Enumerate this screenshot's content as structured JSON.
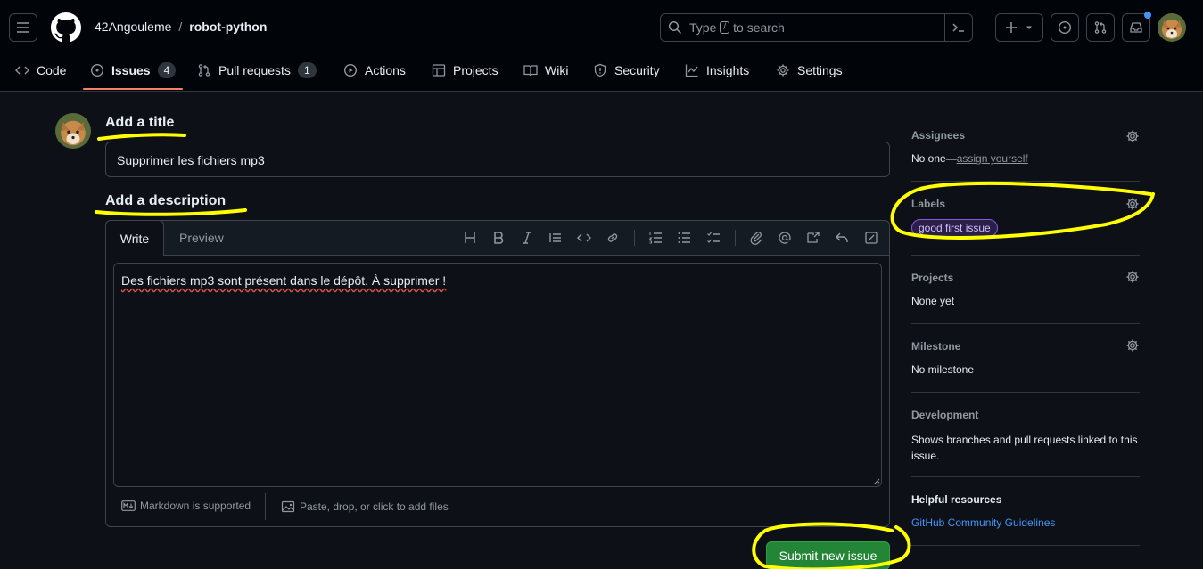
{
  "header": {
    "owner": "42Angouleme",
    "separator": "/",
    "repo": "robot-python",
    "search": {
      "prefix": "Type",
      "key": "/",
      "suffix": "to search"
    }
  },
  "tabs": [
    {
      "label": "Code",
      "icon": "code-icon"
    },
    {
      "label": "Issues",
      "icon": "issue-opened-icon",
      "count": "4",
      "selected": true
    },
    {
      "label": "Pull requests",
      "icon": "git-pull-request-icon",
      "count": "1"
    },
    {
      "label": "Actions",
      "icon": "play-icon"
    },
    {
      "label": "Projects",
      "icon": "table-icon"
    },
    {
      "label": "Wiki",
      "icon": "book-icon"
    },
    {
      "label": "Security",
      "icon": "shield-icon"
    },
    {
      "label": "Insights",
      "icon": "graph-icon"
    },
    {
      "label": "Settings",
      "icon": "gear-icon"
    }
  ],
  "form": {
    "title_heading": "Add a title",
    "title_value": "Supprimer les fichiers mp3",
    "description_heading": "Add a description",
    "write_tab": "Write",
    "preview_tab": "Preview",
    "body_value": "Des fichiers mp3 sont présent dans le dépôt. À supprimer !",
    "markdown_note": "Markdown is supported",
    "attach_note": "Paste, drop, or click to add files",
    "submit_label": "Submit new issue"
  },
  "sidebar": {
    "assignees": {
      "title": "Assignees",
      "value_prefix": "No one—",
      "link": "assign yourself"
    },
    "labels": {
      "title": "Labels",
      "label": "good first issue"
    },
    "projects": {
      "title": "Projects",
      "value": "None yet"
    },
    "milestone": {
      "title": "Milestone",
      "value": "No milestone"
    },
    "development": {
      "title": "Development",
      "value": "Shows branches and pull requests linked to this issue."
    },
    "helpful": {
      "title": "Helpful resources",
      "link": "GitHub Community Guidelines"
    }
  },
  "colors": {
    "background": "#0d1117",
    "header_bg": "#010409",
    "accent_underline": "#f78166",
    "submit_green": "#238636",
    "link_blue": "#4493f8",
    "label_border": "#8957e5",
    "highlight_yellow": "#ffff00"
  }
}
